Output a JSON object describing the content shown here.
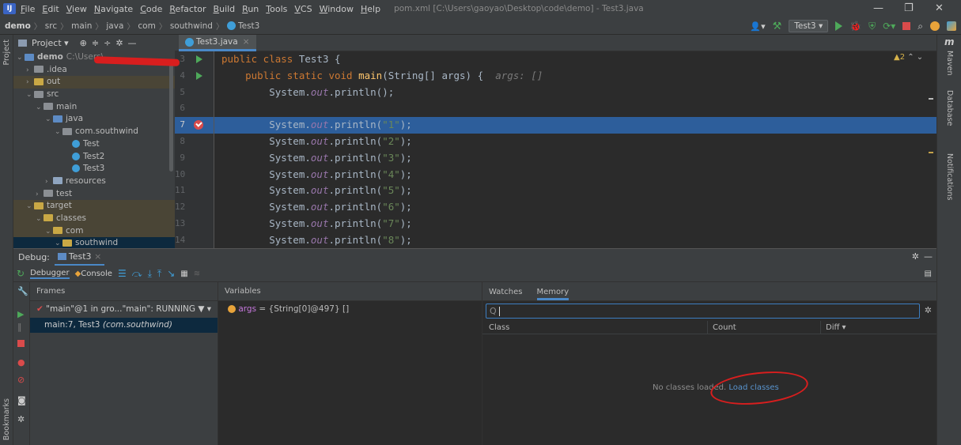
{
  "menu": {
    "items": [
      "File",
      "Edit",
      "View",
      "Navigate",
      "Code",
      "Refactor",
      "Build",
      "Run",
      "Tools",
      "VCS",
      "Window",
      "Help"
    ],
    "window_title": "pom.xml [C:\\Users\\gaoyao\\Desktop\\code\\demo] - Test3.java"
  },
  "navbar": {
    "crumbs": [
      "demo",
      "src",
      "main",
      "java",
      "com",
      "southwind",
      "Test3"
    ],
    "run_config": "Test3"
  },
  "project": {
    "header_label": "Project",
    "tree": [
      {
        "label": "demo",
        "extra": "C:\\Users\\",
        "indent": 0,
        "chev": "v",
        "type": "b"
      },
      {
        "label": ".idea",
        "indent": 1,
        "chev": ">",
        "type": "g"
      },
      {
        "label": "out",
        "indent": 1,
        "chev": ">",
        "type": "o",
        "excl": true
      },
      {
        "label": "src",
        "indent": 1,
        "chev": "v",
        "type": "g"
      },
      {
        "label": "main",
        "indent": 2,
        "chev": "v",
        "type": "g"
      },
      {
        "label": "java",
        "indent": 3,
        "chev": "v",
        "type": "b"
      },
      {
        "label": "com.southwind",
        "indent": 4,
        "chev": "v",
        "type": "g"
      },
      {
        "label": "Test",
        "indent": 5,
        "chev": "",
        "type": "c"
      },
      {
        "label": "Test2",
        "indent": 5,
        "chev": "",
        "type": "c"
      },
      {
        "label": "Test3",
        "indent": 5,
        "chev": "",
        "type": "c"
      },
      {
        "label": "resources",
        "indent": 3,
        "chev": ">",
        "type": "res"
      },
      {
        "label": "test",
        "indent": 2,
        "chev": ">",
        "type": "g"
      },
      {
        "label": "target",
        "indent": 1,
        "chev": "v",
        "type": "o",
        "excl": true
      },
      {
        "label": "classes",
        "indent": 2,
        "chev": "v",
        "type": "o",
        "excl": true
      },
      {
        "label": "com",
        "indent": 3,
        "chev": "v",
        "type": "o",
        "excl": true
      },
      {
        "label": "southwind",
        "indent": 4,
        "chev": "v",
        "type": "o",
        "sel": true
      }
    ]
  },
  "editor": {
    "tab_label": "Test3.java",
    "warnings": "▲2",
    "line_numbers": [
      "3",
      "4",
      "5",
      "6",
      "7",
      "8",
      "9",
      "10",
      "11",
      "12",
      "13",
      "14"
    ],
    "lines": {
      "l3_kw": "public class ",
      "l3_name": "Test3 {",
      "l4_kw": "    public static void ",
      "l4_fn": "main",
      "l4_rest": "(String[] args) {  ",
      "l4_hint": "args: []",
      "l5": "        System.",
      "out": "out",
      "pre": ".println(",
      "l5_end": ");",
      "strings": [
        "\"1\"",
        "\"2\"",
        "\"3\"",
        "\"4\"",
        "\"5\"",
        "\"6\"",
        "\"7\"",
        "\"8\""
      ]
    }
  },
  "debug": {
    "label": "Debug:",
    "session": "Test3",
    "tab_debugger": "Debugger",
    "tab_console": "Console",
    "frames_title": "Frames",
    "thread": "\"main\"@1 in gro...\"main\": RUNNING",
    "frame_main": "main:7, Test3",
    "frame_pkg": "(com.southwind)",
    "variables_title": "Variables",
    "var_name": "args",
    "var_value": " = {String[0]@497} []",
    "watches_tab": "Watches",
    "memory_tab": "Memory",
    "search_placeholder": "Q",
    "col_class": "Class",
    "col_count": "Count",
    "col_diff": "Diff ▾",
    "empty_text": "No classes loaded.",
    "load_link": "Load classes"
  },
  "stripes": {
    "left_top": "Project",
    "left_bottom": "Bookmarks",
    "right": [
      "Maven",
      "Database",
      "Notifications"
    ]
  }
}
